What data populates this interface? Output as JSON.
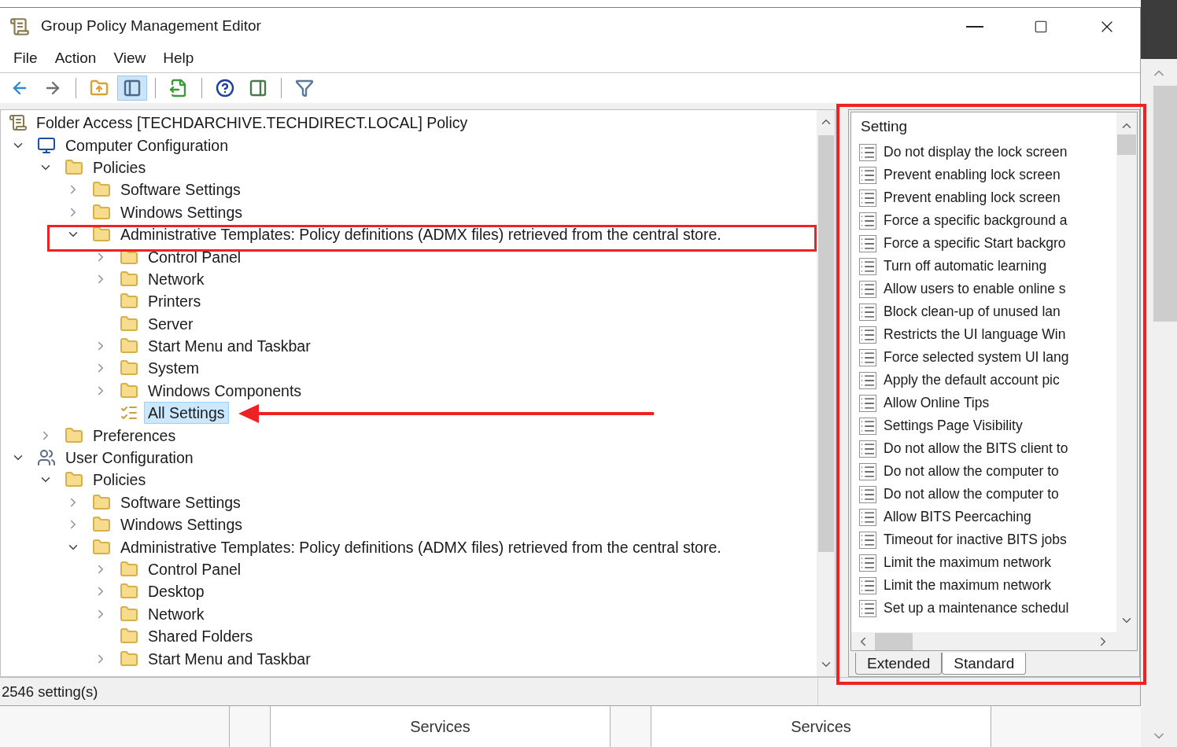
{
  "window": {
    "title": "Group Policy Management Editor"
  },
  "menu": [
    "File",
    "Action",
    "View",
    "Help"
  ],
  "toolbar": [
    {
      "kind": "back",
      "pressed": false
    },
    {
      "kind": "forward",
      "pressed": false
    },
    {
      "kind": "sep"
    },
    {
      "kind": "up",
      "pressed": false
    },
    {
      "kind": "tree",
      "pressed": true
    },
    {
      "kind": "sep"
    },
    {
      "kind": "export",
      "pressed": false
    },
    {
      "kind": "sep"
    },
    {
      "kind": "help",
      "pressed": false
    },
    {
      "kind": "pane",
      "pressed": false
    },
    {
      "kind": "sep"
    },
    {
      "kind": "filter",
      "pressed": false
    }
  ],
  "tree": [
    {
      "label": "Folder Access [TECHDARCHIVE.TECHDIRECT.LOCAL] Policy",
      "kind": "root",
      "children": [
        {
          "label": "Computer Configuration",
          "kind": "computer",
          "expanded": true,
          "selected": false,
          "children": [
            {
              "label": "Policies",
              "kind": "folder",
              "expanded": true,
              "selected": false,
              "children": [
                {
                  "label": "Software Settings",
                  "kind": "folder",
                  "expanded": false,
                  "selected": false
                },
                {
                  "label": "Windows Settings",
                  "kind": "folder",
                  "expanded": false,
                  "selected": false
                },
                {
                  "label": "Administrative Templates: Policy definitions (ADMX files) retrieved from the central store.",
                  "kind": "folder",
                  "expanded": true,
                  "selected": false,
                  "children": [
                    {
                      "label": "Control Panel",
                      "kind": "folder",
                      "expanded": false,
                      "selected": false
                    },
                    {
                      "label": "Network",
                      "kind": "folder",
                      "expanded": false,
                      "selected": false
                    },
                    {
                      "label": "Printers",
                      "kind": "folder",
                      "selected": false
                    },
                    {
                      "label": "Server",
                      "kind": "folder",
                      "selected": false
                    },
                    {
                      "label": "Start Menu and Taskbar",
                      "kind": "folder",
                      "expanded": false,
                      "selected": false
                    },
                    {
                      "label": "System",
                      "kind": "folder",
                      "expanded": false,
                      "selected": false
                    },
                    {
                      "label": "Windows Components",
                      "kind": "folder",
                      "expanded": false,
                      "selected": false
                    },
                    {
                      "label": "All Settings",
                      "kind": "settings",
                      "selected": true
                    }
                  ]
                }
              ]
            },
            {
              "label": "Preferences",
              "kind": "folder",
              "expanded": false,
              "selected": false
            }
          ]
        },
        {
          "label": "User Configuration",
          "kind": "user",
          "expanded": true,
          "selected": false,
          "children": [
            {
              "label": "Policies",
              "kind": "folder",
              "expanded": true,
              "selected": false,
              "children": [
                {
                  "label": "Software Settings",
                  "kind": "folder",
                  "expanded": false,
                  "selected": false
                },
                {
                  "label": "Windows Settings",
                  "kind": "folder",
                  "expanded": false,
                  "selected": false
                },
                {
                  "label": "Administrative Templates: Policy definitions (ADMX files) retrieved from the central store.",
                  "kind": "folder",
                  "expanded": true,
                  "selected": false,
                  "children": [
                    {
                      "label": "Control Panel",
                      "kind": "folder",
                      "expanded": false,
                      "selected": false
                    },
                    {
                      "label": "Desktop",
                      "kind": "folder",
                      "expanded": false,
                      "selected": false
                    },
                    {
                      "label": "Network",
                      "kind": "folder",
                      "expanded": false,
                      "selected": false
                    },
                    {
                      "label": "Shared Folders",
                      "kind": "folder",
                      "selected": false
                    },
                    {
                      "label": "Start Menu and Taskbar",
                      "kind": "folder",
                      "expanded": false,
                      "selected": false
                    }
                  ]
                }
              ]
            }
          ]
        }
      ]
    }
  ],
  "settings": {
    "column": "Setting",
    "rows": [
      "Do not display the lock screen",
      "Prevent enabling lock screen",
      "Prevent enabling lock screen",
      "Force a specific background a",
      "Force a specific Start backgro",
      "Turn off automatic learning",
      "Allow users to enable online s",
      "Block clean-up of unused lan",
      "Restricts the UI language Win",
      "Force selected system UI lang",
      "Apply the default account pic",
      "Allow Online Tips",
      "Settings Page Visibility",
      "Do not allow the BITS client to",
      "Do not allow the computer to",
      "Do not allow the computer to",
      "Allow BITS Peercaching",
      "Timeout for inactive BITS jobs",
      "Limit the maximum network",
      "Limit the maximum network",
      "Set up a maintenance schedul"
    ],
    "tabs": [
      {
        "label": "Extended",
        "selected": false
      },
      {
        "label": "Standard",
        "selected": true
      }
    ]
  },
  "status_bar": "2546 setting(s)",
  "background_columns": [
    "Services",
    "Services"
  ]
}
